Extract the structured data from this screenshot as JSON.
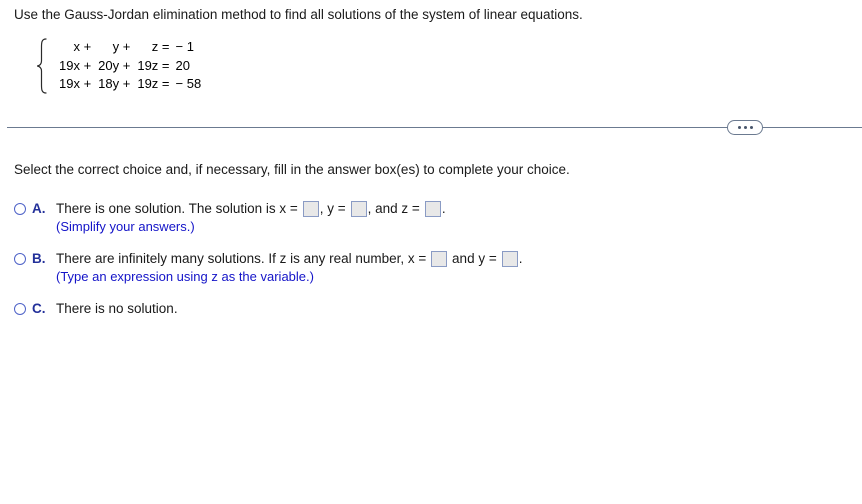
{
  "prompt": "Use the Gauss-Jordan elimination method to find all solutions of the system of linear equations.",
  "system": {
    "brace": "left-curly-brace",
    "rows": [
      {
        "c1": "x +",
        "c2": "y +",
        "c3": "z =",
        "rhs": "− 1"
      },
      {
        "c1": "19x +",
        "c2": "20y +",
        "c3": "19z =",
        "rhs": "20"
      },
      {
        "c1": "19x +",
        "c2": "18y +",
        "c3": "19z =",
        "rhs": "− 58"
      }
    ]
  },
  "divider": {
    "more_button_label": "more-options"
  },
  "instruction": "Select the correct choice and, if necessary, fill in the answer box(es) to complete your choice.",
  "choices": [
    {
      "letter": "A.",
      "segments": [
        "There is one solution. The solution is x =",
        ", y =",
        ", and z =",
        "."
      ],
      "box_count": 3,
      "box_values": [
        "",
        "",
        ""
      ],
      "hint": "(Simplify your answers.)",
      "selected": false
    },
    {
      "letter": "B.",
      "segments": [
        "There are infinitely many solutions. If z is any real number, x =",
        " and y =",
        "."
      ],
      "box_count": 2,
      "box_values": [
        "",
        ""
      ],
      "hint": "(Type an expression using z as the variable.)",
      "selected": false
    },
    {
      "letter": "C.",
      "segments": [
        "There is no solution."
      ],
      "box_count": 0,
      "box_values": [],
      "hint": "",
      "selected": false
    }
  ],
  "colors": {
    "choice_letter": "#23309a",
    "radio_border": "#4f63c8",
    "hint_text": "#1414c8",
    "answer_box_fill": "#e8e8e8",
    "answer_box_border": "#8a9bc4",
    "divider": "#6b7a90",
    "text": "#1a1a1a"
  }
}
